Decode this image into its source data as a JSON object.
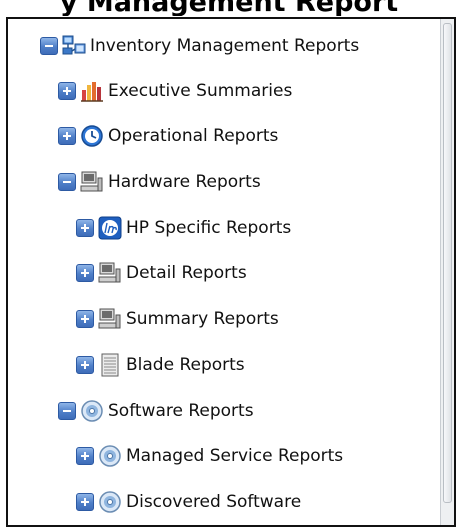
{
  "header": {
    "title": "y Management Report"
  },
  "tree": {
    "items": [
      {
        "label": "Inventory Management Reports",
        "state": "expanded",
        "icon": "network-icon"
      },
      {
        "label": "Executive Summaries",
        "state": "collapsed",
        "icon": "bar-chart-icon"
      },
      {
        "label": "Operational Reports",
        "state": "collapsed",
        "icon": "clock-icon"
      },
      {
        "label": "Hardware Reports",
        "state": "expanded",
        "icon": "computer-icon"
      },
      {
        "label": "HP Specific Reports",
        "state": "collapsed",
        "icon": "hp-logo-icon"
      },
      {
        "label": "Detail Reports",
        "state": "collapsed",
        "icon": "computer-icon"
      },
      {
        "label": "Summary Reports",
        "state": "collapsed",
        "icon": "computer-icon"
      },
      {
        "label": "Blade Reports",
        "state": "collapsed",
        "icon": "server-blade-icon"
      },
      {
        "label": "Software Reports",
        "state": "expanded",
        "icon": "disc-icon"
      },
      {
        "label": "Managed Service Reports",
        "state": "collapsed",
        "icon": "disc-icon"
      },
      {
        "label": "Discovered Software",
        "state": "collapsed",
        "icon": "disc-icon"
      }
    ]
  },
  "colors": {
    "toggle_blue": "#4f7fc8",
    "panel_border": "#111111"
  }
}
